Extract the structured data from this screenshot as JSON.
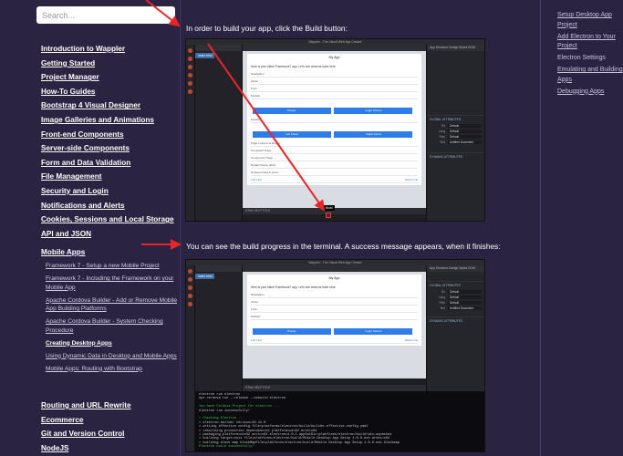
{
  "search": {
    "placeholder": "Search..."
  },
  "sidebar": {
    "top_links": [
      "Introduction to Wappler",
      "Getting Started",
      "Project Manager",
      "How-To Guides",
      "Bootstrap 4 Visual Designer",
      "Image Galleries and Animations",
      "Front-end Components",
      "Server-side Components",
      "Form and Data Validation",
      "File Management",
      "Security and Login",
      "Notifications and Alerts",
      "Cookies, Sessions and Local Storage",
      "API and JSON"
    ],
    "mobile_apps": "Mobile Apps",
    "mobile_sub": [
      "Framework 7 - Setup a new Mobile Project",
      "Framework 7 - Including the Framework on your Mobile App",
      "Apache Cordova Builder - Add or Remove Mobile App Building Platforms",
      "Apache Cordova Builder - System Checking Procedure",
      "Creating Desktop Apps",
      "Using Dynamic Data in Desktop and Mobile Apps",
      "Mobile Apps: Routing with Bootstrap"
    ],
    "bottom_links": [
      "Routing and URL Rewrite",
      "Ecommerce",
      "Git and Version Control",
      "NodeJS"
    ]
  },
  "content": {
    "para1": "In order to build your app, click the Build button:",
    "para2": "You can see the build progress in the terminal. A success message appears, when it finishes:"
  },
  "screenshot": {
    "window_title": "Wappler - The Visual Web App Creator",
    "file_tab": "index.html",
    "canvas_title": "My App",
    "intro_text": "Here is your blank Framework7 app. Let's see what we have here.",
    "navigation_label": "Navigation",
    "nav_rows": [
      "About",
      "Form"
    ],
    "modals_label": "Modals",
    "popup": "Popup",
    "login_screen": "Login Screen",
    "panels_label": "Panels",
    "left_panel": "Left Panel",
    "right_panel": "Right Panel",
    "page_loader_label": "Page Loaders & Router",
    "loader_rows": [
      "Template7 Page",
      "Component Page",
      "Default Route (404)",
      "Request Data & Load"
    ],
    "left_link": "Left Link",
    "right_link": "Right Link",
    "bottom_bar": "HTML   HELP   TITLE",
    "build_tooltip": "Build",
    "right_tabs": "App Structure   Design   Styles   DOM",
    "global_attributes": "GLOBAL ATTRIBUTES",
    "dynamic_attributes": "DYNAMIC ATTRIBUTES",
    "attr_rows": [
      {
        "k": "Dir",
        "v": "Default"
      },
      {
        "k": "Lang",
        "v": "Default"
      },
      {
        "k": "Role",
        "v": "Default"
      },
      {
        "k": "Text",
        "v": "Untitled Document"
      }
    ],
    "terminal_lines": [
      "electron run electron",
      "npx cordova run --release --nobuild electron",
      "",
      "You have Cordova Project for electron ...",
      "electron run successfully!",
      "",
      "> Checking Electron ...",
      "> electron-builder  version=20.41.0",
      "> writing effective config  file=platforms/electron/build/builder-effective-config.yaml",
      "> rebuilding production dependencies  platform=win32 arch=x64",
      "> packaging       platform=win32 arch=x64 electron=4.0.1 appOutDir=platforms/electron/build/win-unpacked",
      "> building        target=nsis file=platforms/electron/build/Mobile Desktop App Setup 1.0.0.exe archs=x64",
      "> building block map  blockMapFile=platforms/electron/build/Mobile Desktop App Setup 1.0.0.exe.blockmap",
      "Electron build successfully!"
    ]
  },
  "toc": {
    "items": [
      "Setup Desktop App Project",
      "Add Electron to Your Project",
      "Electron Settings",
      "Emulating and Building Apps",
      "Debugging Apps"
    ]
  },
  "colors": {
    "background": "#2a2342",
    "accent": "#2f7be8",
    "arrow": "#e8262a"
  }
}
